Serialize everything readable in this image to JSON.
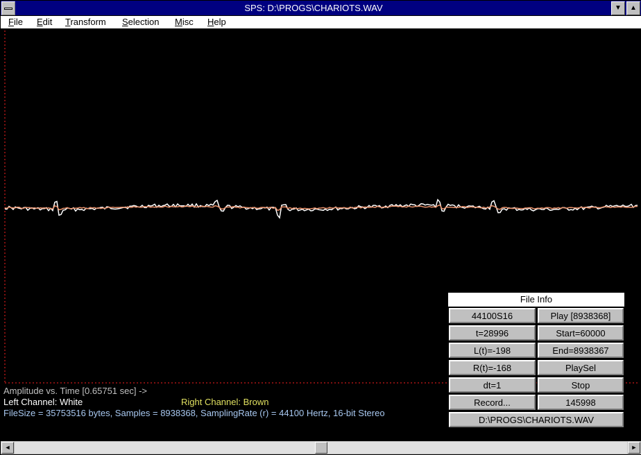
{
  "window": {
    "title": "SPS: D:\\PROGS\\CHARIOTS.WAV"
  },
  "menu": [
    {
      "label": "File",
      "underline": "F",
      "rest": "ile"
    },
    {
      "label": "Edit",
      "underline": "E",
      "rest": "dit"
    },
    {
      "label": "Transform",
      "underline": "T",
      "rest": "ransform"
    },
    {
      "label": "Selection",
      "underline": "S",
      "rest": "election"
    },
    {
      "label": "Misc",
      "underline": "M",
      "rest": "isc"
    },
    {
      "label": "Help",
      "underline": "H",
      "rest": "elp"
    }
  ],
  "info": {
    "amplitude_label": "Amplitude vs. Time [0.65751 sec] ->",
    "left_channel": "Left Channel: White",
    "right_channel": "Right Channel: Brown",
    "file_line": "FileSize = 35753516 bytes, Samples = 8938368, SamplingRate (r) = 44100 Hertz, 16-bit Stereo"
  },
  "file_info": {
    "title": "File Info",
    "buttons": {
      "format": "44100S16",
      "play": "Play [8938368]",
      "t": "t=28996",
      "start": "Start=60000",
      "lt": "L(t)=-198",
      "end": "End=8938367",
      "rt": "R(t)=-168",
      "playsel": "PlaySel",
      "dt": "dt=1",
      "stop": "Stop",
      "record": "Record...",
      "count": "145998",
      "filename": "D:\\PROGS\\CHARIOTS.WAV"
    }
  },
  "colors": {
    "left_channel": "#ffffff",
    "right_channel": "#e8906a",
    "axis": "#ff2020",
    "titlebar": "#000080"
  },
  "scroll": {
    "position_fraction": 0.5
  }
}
